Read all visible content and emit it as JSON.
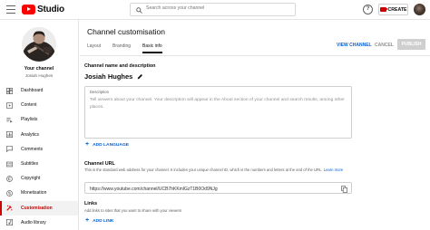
{
  "header": {
    "logo_text": "Studio",
    "search_placeholder": "Search across your channel",
    "create_label": "CREATE",
    "help_symbol": "?"
  },
  "sidebar": {
    "channel_label": "Your channel",
    "channel_name": "Josiah Hughes",
    "items": [
      {
        "label": "Dashboard",
        "icon": "dashboard-icon",
        "active": false
      },
      {
        "label": "Content",
        "icon": "content-icon",
        "active": false
      },
      {
        "label": "Playlists",
        "icon": "playlists-icon",
        "active": false
      },
      {
        "label": "Analytics",
        "icon": "analytics-icon",
        "active": false
      },
      {
        "label": "Comments",
        "icon": "comments-icon",
        "active": false
      },
      {
        "label": "Subtitles",
        "icon": "subtitles-icon",
        "active": false
      },
      {
        "label": "Copyright",
        "icon": "copyright-icon",
        "active": false
      },
      {
        "label": "Monetisation",
        "icon": "monetisation-icon",
        "active": false
      },
      {
        "label": "Customisation",
        "icon": "customisation-icon",
        "active": true
      },
      {
        "label": "Audio library",
        "icon": "audio-library-icon",
        "active": false
      }
    ]
  },
  "main": {
    "title": "Channel customisation",
    "tabs": [
      {
        "label": "Layout",
        "active": false
      },
      {
        "label": "Branding",
        "active": false
      },
      {
        "label": "Basic info",
        "active": true
      }
    ],
    "view_channel_label": "VIEW CHANNEL",
    "cancel_label": "CANCEL",
    "publish_label": "PUBLISH",
    "name_section": {
      "title": "Channel name and description",
      "name": "Josiah Hughes"
    },
    "description": {
      "label": "Description",
      "placeholder": "Tell viewers about your channel. Your description will appear in the About section of your channel and search results, among other places."
    },
    "add_language_label": "ADD LANGUAGE",
    "url_section": {
      "title": "Channel URL",
      "helper": "This is the standard web address for your channel. It includes your unique channel ID, which is the numbers and letters at the end of the URL.",
      "learn_more": "Learn more",
      "url": "https://www.youtube.com/channel/UCB7hKKmlGzT1B0Od9NJg"
    },
    "links_section": {
      "title": "Links",
      "helper": "Add links to sites that you want to share with your viewers",
      "add_link_label": "ADD LINK"
    }
  },
  "colors": {
    "accent_red": "#cc0000",
    "link_blue": "#065fd4",
    "logo_red": "#ff0000"
  }
}
